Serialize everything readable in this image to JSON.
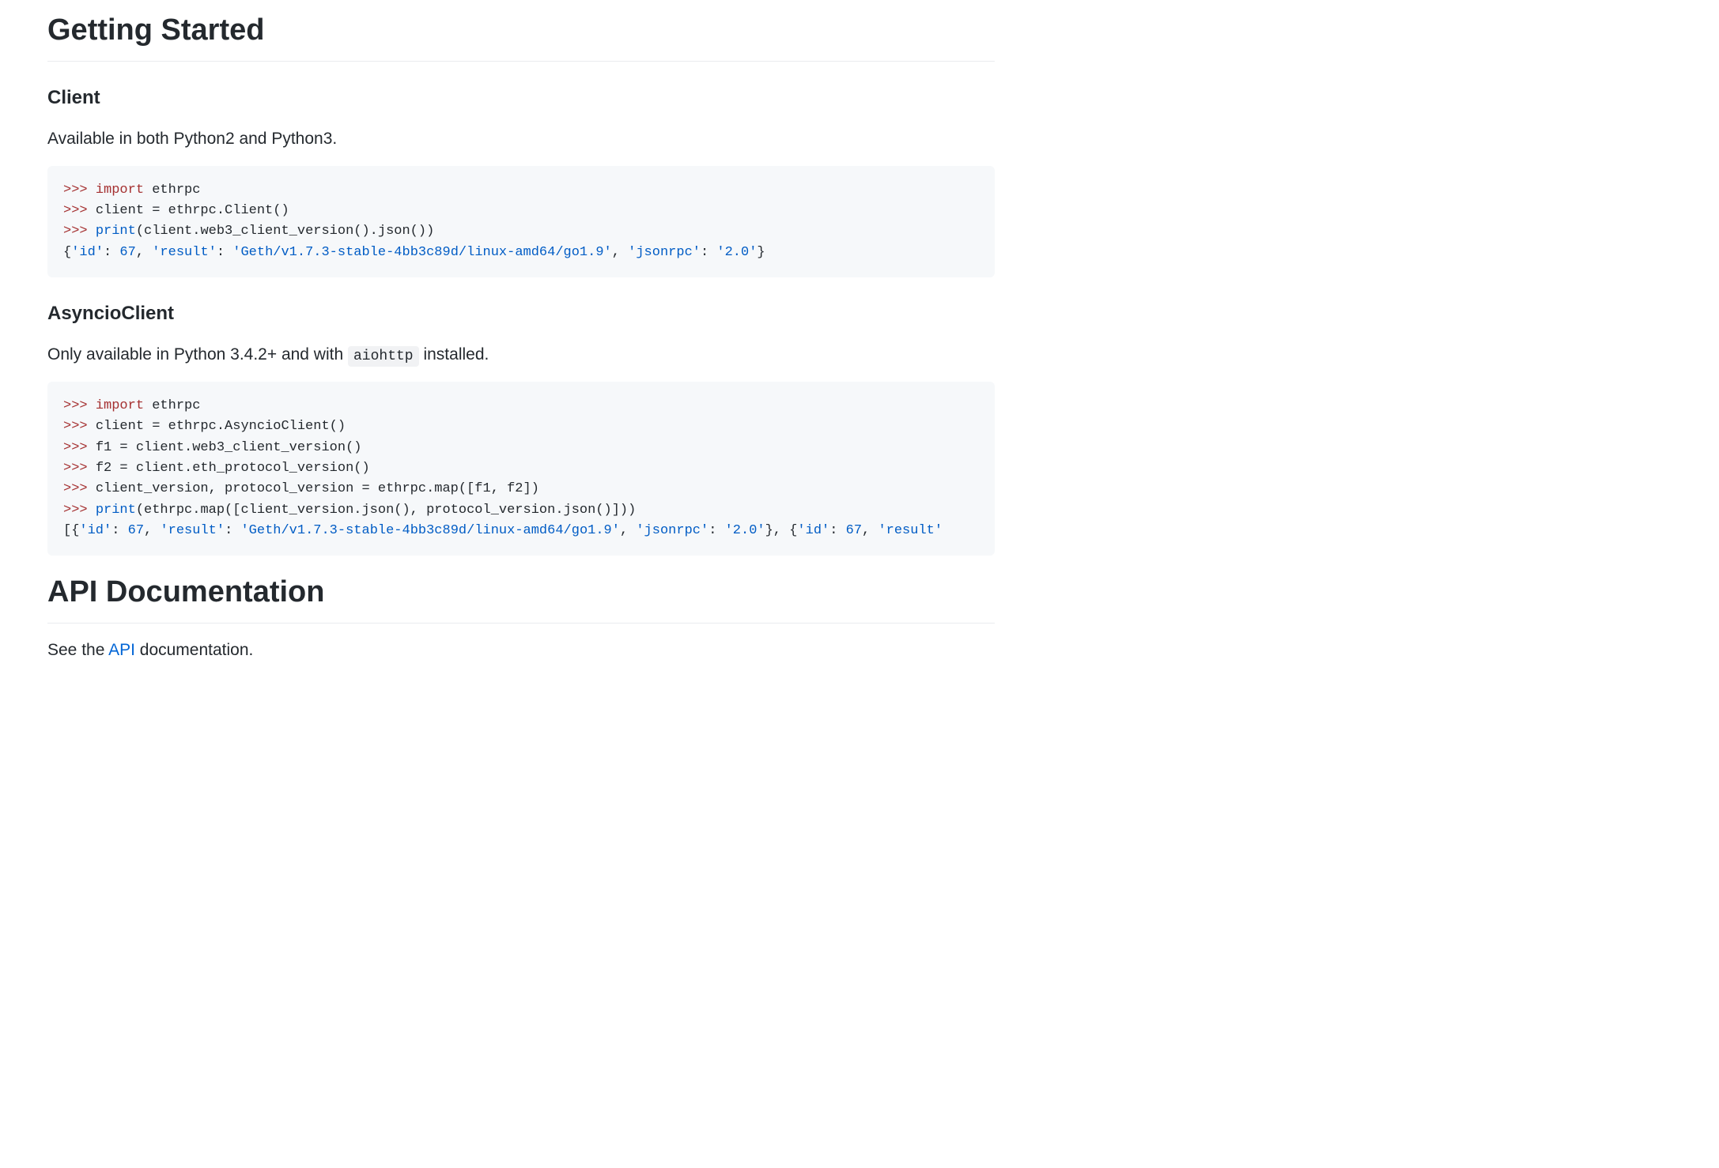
{
  "sections": {
    "started": {
      "heading": "Getting Started",
      "client": {
        "title": "Client",
        "desc": "Available in both Python2 and Python3.",
        "code": [
          {
            "segs": [
              {
                "c": "t-prompt",
                "t": ">>> "
              },
              {
                "c": "t-keyword",
                "t": "import"
              },
              {
                "c": "t-default",
                "t": " ethrpc"
              }
            ]
          },
          {
            "segs": [
              {
                "c": "t-prompt",
                "t": ">>> "
              },
              {
                "c": "t-default",
                "t": "client = ethrpc.Client()"
              }
            ]
          },
          {
            "segs": [
              {
                "c": "t-prompt",
                "t": ">>> "
              },
              {
                "c": "t-builtin",
                "t": "print"
              },
              {
                "c": "t-default",
                "t": "(client.web3_client_version().json())"
              }
            ]
          },
          {
            "segs": [
              {
                "c": "t-default",
                "t": "{"
              },
              {
                "c": "t-string",
                "t": "'id'"
              },
              {
                "c": "t-default",
                "t": ": "
              },
              {
                "c": "t-number",
                "t": "67"
              },
              {
                "c": "t-default",
                "t": ", "
              },
              {
                "c": "t-string",
                "t": "'result'"
              },
              {
                "c": "t-default",
                "t": ": "
              },
              {
                "c": "t-string",
                "t": "'Geth/v1.7.3-stable-4bb3c89d/linux-amd64/go1.9'"
              },
              {
                "c": "t-default",
                "t": ", "
              },
              {
                "c": "t-string",
                "t": "'jsonrpc'"
              },
              {
                "c": "t-default",
                "t": ": "
              },
              {
                "c": "t-string",
                "t": "'2.0'"
              },
              {
                "c": "t-default",
                "t": "}"
              }
            ]
          }
        ]
      },
      "asyncio": {
        "title": "AsyncioClient",
        "desc_pre": "Only available in Python 3.4.2+ and with ",
        "desc_code": "aiohttp",
        "desc_post": " installed.",
        "code": [
          {
            "segs": [
              {
                "c": "t-prompt",
                "t": ">>> "
              },
              {
                "c": "t-keyword",
                "t": "import"
              },
              {
                "c": "t-default",
                "t": " ethrpc"
              }
            ]
          },
          {
            "segs": [
              {
                "c": "t-prompt",
                "t": ">>> "
              },
              {
                "c": "t-default",
                "t": "client = ethrpc.AsyncioClient()"
              }
            ]
          },
          {
            "segs": [
              {
                "c": "t-prompt",
                "t": ">>> "
              },
              {
                "c": "t-default",
                "t": "f1 = client.web3_client_version()"
              }
            ]
          },
          {
            "segs": [
              {
                "c": "t-prompt",
                "t": ">>> "
              },
              {
                "c": "t-default",
                "t": "f2 = client.eth_protocol_version()"
              }
            ]
          },
          {
            "segs": [
              {
                "c": "t-prompt",
                "t": ">>> "
              },
              {
                "c": "t-default",
                "t": "client_version, protocol_version = ethrpc.map([f1, f2])"
              }
            ]
          },
          {
            "segs": [
              {
                "c": "t-prompt",
                "t": ">>> "
              },
              {
                "c": "t-builtin",
                "t": "print"
              },
              {
                "c": "t-default",
                "t": "(ethrpc.map([client_version.json(), protocol_version.json()]))"
              }
            ]
          },
          {
            "segs": [
              {
                "c": "t-default",
                "t": "[{"
              },
              {
                "c": "t-string",
                "t": "'id'"
              },
              {
                "c": "t-default",
                "t": ": "
              },
              {
                "c": "t-number",
                "t": "67"
              },
              {
                "c": "t-default",
                "t": ", "
              },
              {
                "c": "t-string",
                "t": "'result'"
              },
              {
                "c": "t-default",
                "t": ": "
              },
              {
                "c": "t-string",
                "t": "'Geth/v1.7.3-stable-4bb3c89d/linux-amd64/go1.9'"
              },
              {
                "c": "t-default",
                "t": ", "
              },
              {
                "c": "t-string",
                "t": "'jsonrpc'"
              },
              {
                "c": "t-default",
                "t": ": "
              },
              {
                "c": "t-string",
                "t": "'2.0'"
              },
              {
                "c": "t-default",
                "t": "}, {"
              },
              {
                "c": "t-string",
                "t": "'id'"
              },
              {
                "c": "t-default",
                "t": ": "
              },
              {
                "c": "t-number",
                "t": "67"
              },
              {
                "c": "t-default",
                "t": ", "
              },
              {
                "c": "t-string",
                "t": "'result'"
              }
            ]
          }
        ]
      }
    },
    "api": {
      "heading": "API Documentation",
      "desc_pre": "See the ",
      "link_text": "API",
      "desc_post": " documentation."
    }
  }
}
